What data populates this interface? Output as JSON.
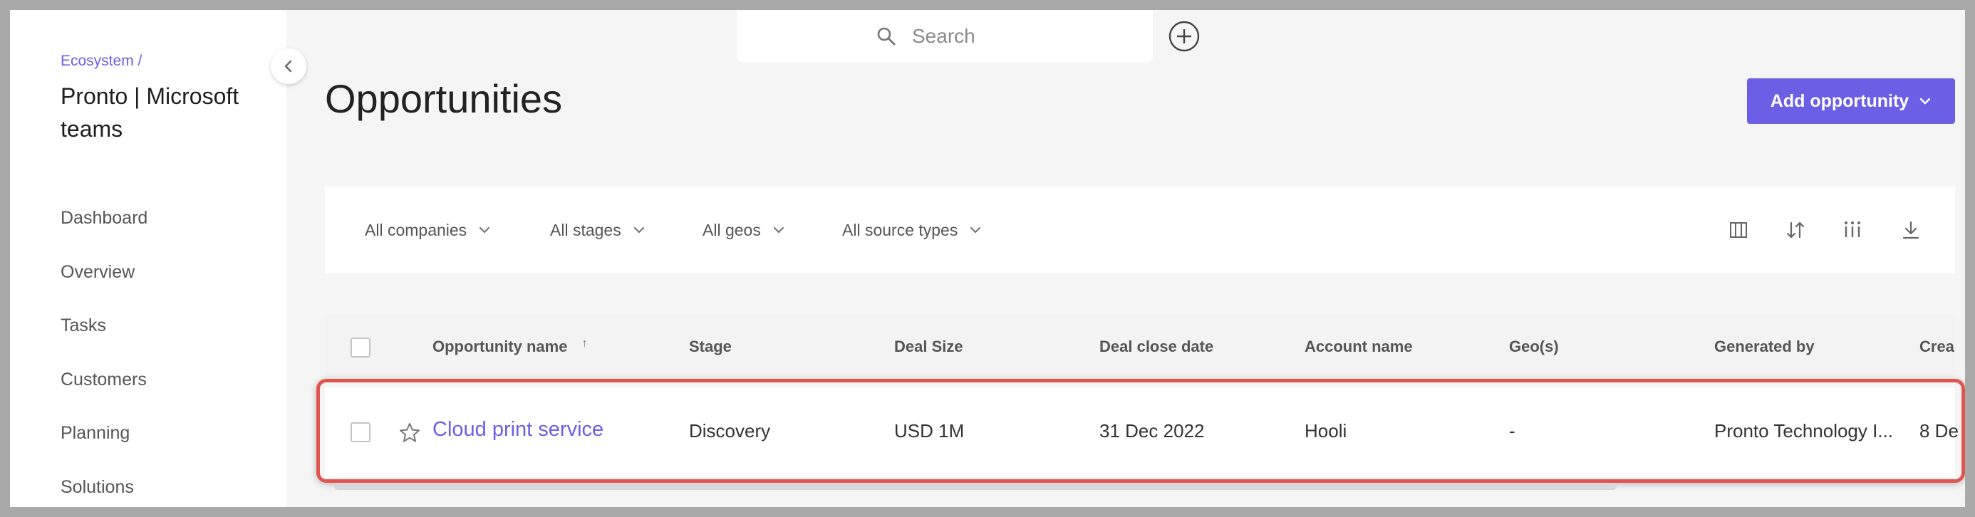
{
  "sidebar": {
    "breadcrumb": "Ecosystem /",
    "project_title": "Pronto | Microsoft teams",
    "items": [
      {
        "label": "Dashboard"
      },
      {
        "label": "Overview"
      },
      {
        "label": "Tasks"
      },
      {
        "label": "Customers"
      },
      {
        "label": "Planning"
      },
      {
        "label": "Solutions"
      }
    ]
  },
  "search": {
    "placeholder": "Search"
  },
  "page": {
    "title": "Opportunities",
    "add_button": "Add opportunity"
  },
  "filters": [
    {
      "label": "All companies"
    },
    {
      "label": "All stages"
    },
    {
      "label": "All geos"
    },
    {
      "label": "All source types"
    }
  ],
  "toolbar_icons": [
    "columns-icon",
    "sort-icon",
    "filter-columns-icon",
    "download-icon"
  ],
  "table": {
    "columns": [
      {
        "label": "Opportunity name",
        "sort": "↑"
      },
      {
        "label": "Stage"
      },
      {
        "label": "Deal Size"
      },
      {
        "label": "Deal close date"
      },
      {
        "label": "Account name"
      },
      {
        "label": "Geo(s)"
      },
      {
        "label": "Generated by"
      },
      {
        "label": "Crea"
      }
    ],
    "rows": [
      {
        "name": "Cloud print service",
        "stage": "Discovery",
        "deal_size": "USD 1M",
        "close_date": "31 Dec 2022",
        "account": "Hooli",
        "geos": "-",
        "generated_by": "Pronto Technology I...",
        "created": "8 De"
      }
    ]
  },
  "colors": {
    "accent": "#6b5fe6",
    "highlight": "#e0554f"
  }
}
